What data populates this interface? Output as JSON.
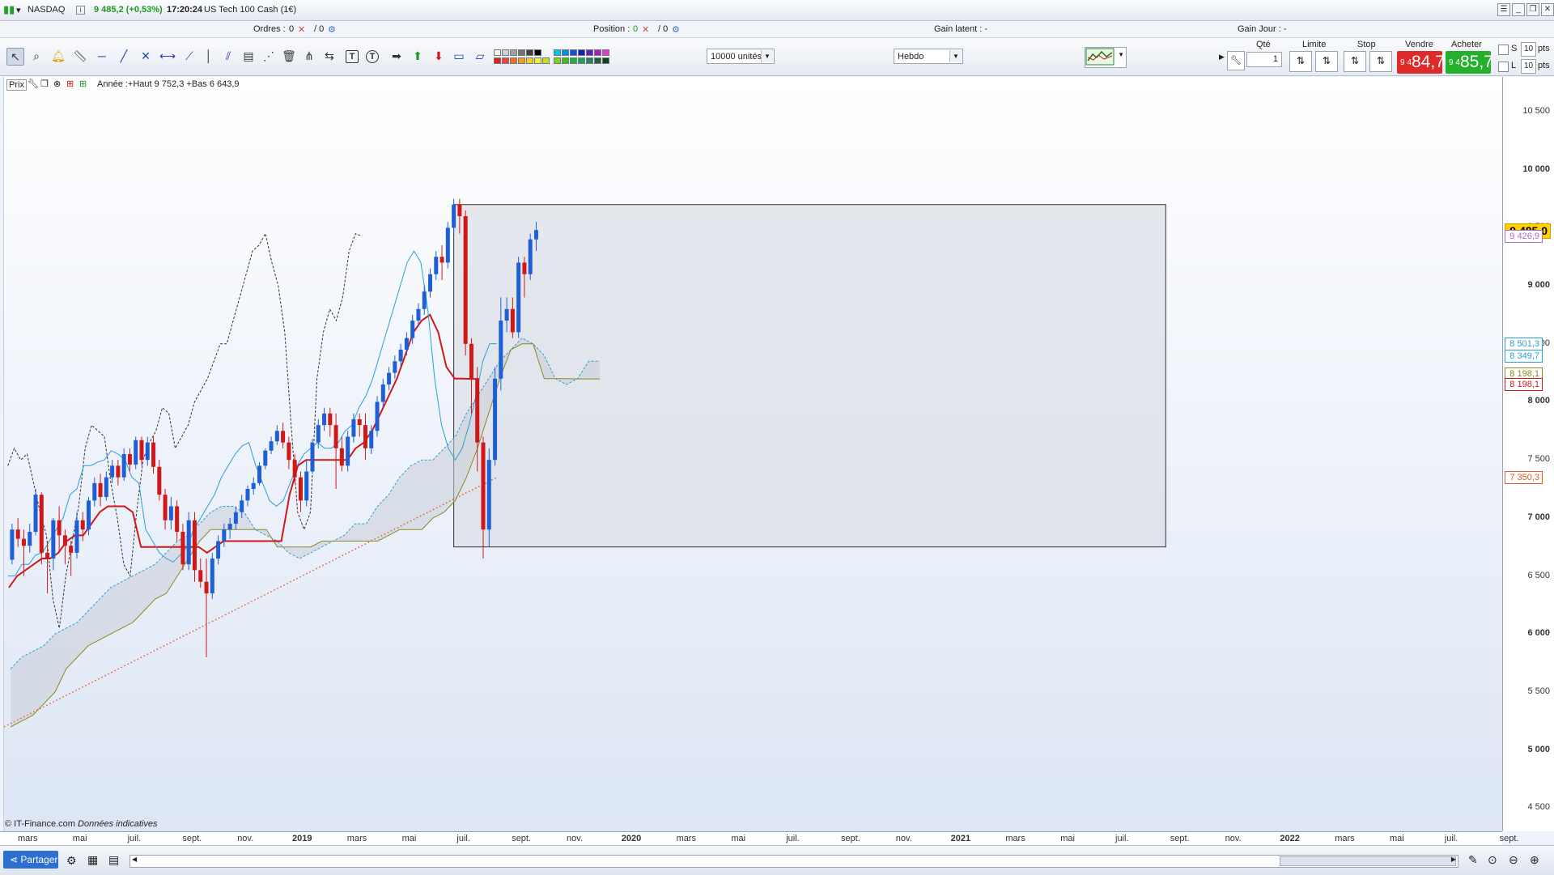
{
  "titlebar": {
    "symbol": "NASDAQ",
    "change": "9 485,2 (+0,53%)",
    "time": "17:20:24",
    "instrument": "US Tech 100 Cash (1€)"
  },
  "ordersbar": {
    "orders_label": "Ordres :",
    "orders_count": "0",
    "orders_sep": "/ 0",
    "position_label": "Position :",
    "position_count": "0",
    "position_sep": "/ 0",
    "gain_latent": "Gain latent : -",
    "gain_jour": "Gain Jour : -"
  },
  "toolbar": {
    "units": "10000 unités",
    "period": "Hebdo",
    "qty_label": "Qté",
    "qty_value": "1",
    "limit_label": "Limite",
    "stop_label": "Stop",
    "sell_label": "Vendre",
    "buy_label": "Acheter",
    "sell_small": "9 4",
    "sell_big": "84,7",
    "buy_small": "9 4",
    "buy_big": "85,7",
    "s_label": "S",
    "l_label": "L",
    "s_pts": "10",
    "l_pts": "10",
    "pts": "pts",
    "sell_color": "#e02a2a",
    "buy_color": "#25b02c"
  },
  "chart_header": {
    "prix": "Prix",
    "info": "Année :+Haut 9 752,3 +Bas 6 643,9"
  },
  "chart_data": {
    "type": "candlestick",
    "timeframe": "weekly",
    "y_range": [
      4300,
      10800
    ],
    "yticks": [
      "10 500",
      "10 000",
      "9 500",
      "9 000",
      "8 500",
      "8 000",
      "7 500",
      "7 000",
      "6 500",
      "6 000",
      "5 500",
      "5 000",
      "4 500"
    ],
    "yticks_values": [
      10500,
      10000,
      9500,
      9000,
      8500,
      8000,
      7500,
      7000,
      6500,
      6000,
      5500,
      5000,
      4500
    ],
    "x_labels": [
      "mars",
      "mai",
      "juil.",
      "sept.",
      "nov.",
      "2019",
      "mars",
      "mai",
      "juil.",
      "sept.",
      "nov.",
      "2020",
      "mars",
      "mai",
      "juil.",
      "sept.",
      "nov.",
      "2021",
      "mars",
      "mai",
      "juil.",
      "sept.",
      "nov.",
      "2022",
      "mars",
      "mai",
      "juil.",
      "sept."
    ],
    "price_labels": [
      {
        "text": "9 485,0",
        "value": 9485,
        "bg": "#ffd200",
        "fg": "#000",
        "border": "#c9a400",
        "bold": true
      },
      {
        "text": "9 426,9",
        "value": 9426.9,
        "bg": "#ffffff",
        "fg": "#b066d0",
        "border": "#b066d0"
      },
      {
        "text": "8 501,3",
        "value": 8501.3,
        "bg": "#ffffff",
        "fg": "#2a9fd6",
        "border": "#2a9fd6"
      },
      {
        "text": "8 349,7",
        "value": 8349.7,
        "bg": "#ffffff",
        "fg": "#2a9fd6",
        "border": "#2a9fd6"
      },
      {
        "text": "8 198,1",
        "value": 8198.1,
        "bg": "#ffffff",
        "fg": "#8a8a20",
        "border": "#8a8a20"
      },
      {
        "text": "8 198,1",
        "value": 8198.1,
        "bg": "#ffffff",
        "fg": "#d01818",
        "border": "#d01818"
      },
      {
        "text": "7 350,3",
        "value": 7350.3,
        "bg": "#ffffff",
        "fg": "#e05a2a",
        "border": "#e05a2a"
      }
    ],
    "candles": [
      [
        6640,
        6900,
        6600,
        6950
      ],
      [
        6900,
        6820,
        6750,
        7000
      ],
      [
        6820,
        6760,
        6500,
        6900
      ],
      [
        6760,
        6880,
        6700,
        6950
      ],
      [
        6880,
        7200,
        6850,
        7250
      ],
      [
        7200,
        6700,
        6600,
        7220
      ],
      [
        6700,
        6650,
        6350,
        6800
      ],
      [
        6650,
        6980,
        6550,
        7000
      ],
      [
        6980,
        6850,
        6700,
        7100
      ],
      [
        6850,
        6760,
        6600,
        6900
      ],
      [
        6760,
        6700,
        6500,
        6800
      ],
      [
        6700,
        6980,
        6650,
        7050
      ],
      [
        6980,
        6900,
        6800,
        7050
      ],
      [
        6900,
        7150,
        6850,
        7180
      ],
      [
        7150,
        7300,
        7100,
        7350
      ],
      [
        7300,
        7180,
        7100,
        7380
      ],
      [
        7180,
        7350,
        7150,
        7400
      ],
      [
        7350,
        7450,
        7300,
        7500
      ],
      [
        7450,
        7350,
        7280,
        7500
      ],
      [
        7350,
        7550,
        7320,
        7600
      ],
      [
        7550,
        7460,
        7400,
        7600
      ],
      [
        7460,
        7670,
        7420,
        7700
      ],
      [
        7670,
        7500,
        7450,
        7700
      ],
      [
        7500,
        7650,
        7450,
        7700
      ],
      [
        7650,
        7440,
        7380,
        7700
      ],
      [
        7440,
        7200,
        7150,
        7500
      ],
      [
        7200,
        6980,
        6900,
        7250
      ],
      [
        6980,
        7100,
        6900,
        7180
      ],
      [
        7100,
        6880,
        6800,
        7150
      ],
      [
        6880,
        6600,
        6550,
        6950
      ],
      [
        6600,
        6980,
        6550,
        7050
      ],
      [
        6980,
        6550,
        6450,
        7050
      ],
      [
        6550,
        6450,
        6400,
        6650
      ],
      [
        6450,
        6350,
        5800,
        6650
      ],
      [
        6350,
        6650,
        6300,
        6700
      ],
      [
        6650,
        6800,
        6600,
        6850
      ],
      [
        6800,
        6900,
        6750,
        6950
      ],
      [
        6900,
        6950,
        6820,
        7000
      ],
      [
        6950,
        7050,
        6900,
        7100
      ],
      [
        7050,
        7150,
        7000,
        7200
      ],
      [
        7150,
        7250,
        7100,
        7280
      ],
      [
        7250,
        7300,
        7200,
        7350
      ],
      [
        7300,
        7450,
        7280,
        7480
      ],
      [
        7450,
        7580,
        7420,
        7600
      ],
      [
        7580,
        7660,
        7550,
        7700
      ],
      [
        7660,
        7750,
        7630,
        7800
      ],
      [
        7750,
        7650,
        7600,
        7820
      ],
      [
        7650,
        7500,
        7420,
        7700
      ],
      [
        7500,
        7350,
        7300,
        7550
      ],
      [
        7350,
        7150,
        7050,
        7400
      ],
      [
        7150,
        7400,
        7100,
        7500
      ],
      [
        7400,
        7650,
        7380,
        7680
      ],
      [
        7650,
        7800,
        7600,
        7850
      ],
      [
        7800,
        7900,
        7750,
        7950
      ],
      [
        7900,
        7800,
        7700,
        7950
      ],
      [
        7800,
        7600,
        7250,
        7900
      ],
      [
        7600,
        7450,
        7400,
        7700
      ],
      [
        7450,
        7700,
        7400,
        7750
      ],
      [
        7700,
        7850,
        7650,
        7900
      ],
      [
        7850,
        7800,
        7700,
        7900
      ],
      [
        7800,
        7600,
        7500,
        7900
      ],
      [
        7600,
        7750,
        7550,
        7800
      ],
      [
        7750,
        8000,
        7700,
        8050
      ],
      [
        8000,
        8150,
        7950,
        8200
      ],
      [
        8150,
        8250,
        8100,
        8300
      ],
      [
        8250,
        8350,
        8200,
        8400
      ],
      [
        8350,
        8450,
        8300,
        8500
      ],
      [
        8450,
        8550,
        8400,
        8600
      ],
      [
        8550,
        8700,
        8500,
        8750
      ],
      [
        8700,
        8800,
        8650,
        8850
      ],
      [
        8800,
        8950,
        8750,
        9000
      ],
      [
        8950,
        9100,
        8900,
        9150
      ],
      [
        9100,
        9250,
        9050,
        9300
      ],
      [
        9250,
        9200,
        9050,
        9350
      ],
      [
        9200,
        9500,
        9150,
        9550
      ],
      [
        9500,
        9700,
        9450,
        9750
      ],
      [
        9700,
        9600,
        9450,
        9750
      ],
      [
        9600,
        8500,
        8400,
        9650
      ],
      [
        8500,
        8200,
        7900,
        8550
      ],
      [
        8200,
        7650,
        7400,
        8300
      ],
      [
        7650,
        6900,
        6650,
        7700
      ],
      [
        6900,
        7500,
        6750,
        7600
      ],
      [
        7500,
        8200,
        7450,
        8300
      ],
      [
        8200,
        8700,
        8100,
        8900
      ],
      [
        8700,
        8800,
        8600,
        8900
      ],
      [
        8800,
        8600,
        8550,
        8900
      ],
      [
        8600,
        9200,
        8550,
        9250
      ],
      [
        9200,
        9100,
        8900,
        9250
      ],
      [
        9100,
        9400,
        9050,
        9450
      ],
      [
        9400,
        9480,
        9300,
        9550
      ]
    ],
    "tenkan": [
      [
        6500,
        6500
      ],
      [
        6600,
        6600
      ],
      [
        6680,
        6700
      ],
      [
        6800,
        6900
      ],
      [
        7000,
        7200
      ],
      [
        7250,
        7450
      ],
      [
        7450,
        7480
      ],
      [
        7500,
        7580
      ],
      [
        7550,
        7500
      ],
      [
        7350,
        7300
      ],
      [
        6900,
        6800
      ],
      [
        6700,
        6650
      ],
      [
        6620,
        6680
      ],
      [
        6750,
        6900
      ],
      [
        7000,
        7100
      ],
      [
        7200,
        7350
      ],
      [
        7450,
        7550
      ],
      [
        7620,
        7650
      ],
      [
        7450,
        7300
      ],
      [
        7150,
        7100
      ],
      [
        7150,
        7300
      ],
      [
        7450,
        7550
      ],
      [
        7600,
        7650
      ],
      [
        7600,
        7600
      ],
      [
        7650,
        7750
      ],
      [
        7800,
        7950
      ],
      [
        8050,
        8200
      ],
      [
        8400,
        8600
      ],
      [
        8800,
        9000
      ],
      [
        9200,
        9300
      ],
      [
        9200,
        8800
      ],
      [
        8200,
        7800
      ],
      [
        7600,
        7500
      ],
      [
        7600,
        7800
      ],
      [
        8050,
        8350
      ],
      [
        8501.3,
        8501.3
      ]
    ],
    "kijun": [
      [
        6400,
        6500
      ],
      [
        6550,
        6600
      ],
      [
        6650,
        6650
      ],
      [
        6700,
        6800
      ],
      [
        6850,
        6850
      ],
      [
        6950,
        7050
      ],
      [
        7100,
        7100
      ],
      [
        7100,
        7050
      ],
      [
        6750,
        6750
      ],
      [
        6750,
        6750
      ],
      [
        6750,
        6750
      ],
      [
        6750,
        6750
      ],
      [
        6700,
        6750
      ],
      [
        6800,
        6800
      ],
      [
        6800,
        6800
      ],
      [
        6800,
        6800
      ],
      [
        6800,
        6800
      ],
      [
        7200,
        7450
      ],
      [
        7500,
        7500
      ],
      [
        7500,
        7500
      ],
      [
        7500,
        7500
      ],
      [
        7600,
        7650
      ],
      [
        7750,
        7900
      ],
      [
        8050,
        8200
      ],
      [
        8400,
        8600
      ],
      [
        8700,
        8750
      ],
      [
        8600,
        8300
      ],
      [
        8200,
        8200
      ],
      [
        8198.1,
        8198.1
      ]
    ],
    "chikou": [
      [
        7450,
        7600
      ],
      [
        7500,
        7550
      ],
      [
        7300,
        7050
      ],
      [
        6850,
        6300
      ],
      [
        6050,
        6500
      ],
      [
        6800,
        7100
      ],
      [
        7600,
        7800
      ],
      [
        7750,
        7700
      ],
      [
        7300,
        7000
      ],
      [
        6600,
        6500
      ],
      [
        7050,
        7500
      ],
      [
        7650,
        7750
      ],
      [
        7950,
        7900
      ],
      [
        7600,
        7700
      ],
      [
        7800,
        8000
      ],
      [
        8100,
        8200
      ],
      [
        8350,
        8500
      ],
      [
        8500,
        8700
      ],
      [
        8900,
        9100
      ],
      [
        9300,
        9350
      ],
      [
        9450,
        9200
      ],
      [
        9000,
        8600
      ],
      [
        7800,
        7050
      ],
      [
        6900,
        7050
      ],
      [
        8200,
        8600
      ],
      [
        8800,
        8700
      ],
      [
        8900,
        9300
      ],
      [
        9450,
        9426.9
      ]
    ],
    "ssa": [
      [
        5700,
        5800
      ],
      [
        5850,
        5900
      ],
      [
        6000,
        6050
      ],
      [
        6100,
        6200
      ],
      [
        6300,
        6400
      ],
      [
        6450,
        6500
      ],
      [
        6550,
        6600
      ],
      [
        6700,
        6800
      ],
      [
        6850,
        6950
      ],
      [
        7050,
        7100
      ],
      [
        7100,
        7050
      ],
      [
        6900,
        6850
      ],
      [
        6800,
        6700
      ],
      [
        6650,
        6700
      ],
      [
        6750,
        6800
      ],
      [
        6850,
        6950
      ],
      [
        6950,
        7100
      ],
      [
        7200,
        7350
      ],
      [
        7450,
        7500
      ],
      [
        7500,
        7600
      ],
      [
        7700,
        7900
      ],
      [
        8050,
        8200
      ],
      [
        8350,
        8450
      ],
      [
        8550,
        8500
      ],
      [
        8400,
        8200
      ],
      [
        8150,
        8200
      ],
      [
        8349.7,
        8349.7
      ]
    ],
    "ssb": [
      [
        5200,
        5250
      ],
      [
        5300,
        5400
      ],
      [
        5500,
        5700
      ],
      [
        5800,
        5900
      ],
      [
        5950,
        6000
      ],
      [
        6050,
        6100
      ],
      [
        6200,
        6300
      ],
      [
        6350,
        6500
      ],
      [
        6650,
        6800
      ],
      [
        6900,
        6900
      ],
      [
        6900,
        6900
      ],
      [
        6900,
        6900
      ],
      [
        6750,
        6750
      ],
      [
        6750,
        6750
      ],
      [
        6800,
        6800
      ],
      [
        6800,
        6800
      ],
      [
        6800,
        6800
      ],
      [
        6850,
        6900
      ],
      [
        6900,
        6900
      ],
      [
        7000,
        7050
      ],
      [
        7150,
        7350
      ],
      [
        7600,
        7900
      ],
      [
        8200,
        8450
      ],
      [
        8500,
        8500
      ],
      [
        8200,
        8200
      ],
      [
        8200,
        8198.1
      ],
      [
        8198.1,
        8198.1
      ]
    ],
    "ma": [
      5200,
      7350.3
    ],
    "rectangle": {
      "x0": 0.3,
      "x1": 0.775,
      "y_top": 9700,
      "y_bottom": 6750
    },
    "colors": {
      "bull": "#1f5fd6",
      "bear": "#d01818",
      "tenkan": "#2a9fd6",
      "kijun": "#d01818",
      "chikou": "#333333",
      "ssa": "#2a9fd6",
      "ssb": "#8a8a20",
      "ma": "#e05a2a",
      "cloud": "#c9ced8",
      "rect_fill": "#d7dbe2",
      "rect_stroke": "#333333"
    }
  },
  "credit": {
    "source": "© IT-Finance.com",
    "note": "Données indicatives"
  },
  "footer": {
    "share_label": "Partager"
  }
}
